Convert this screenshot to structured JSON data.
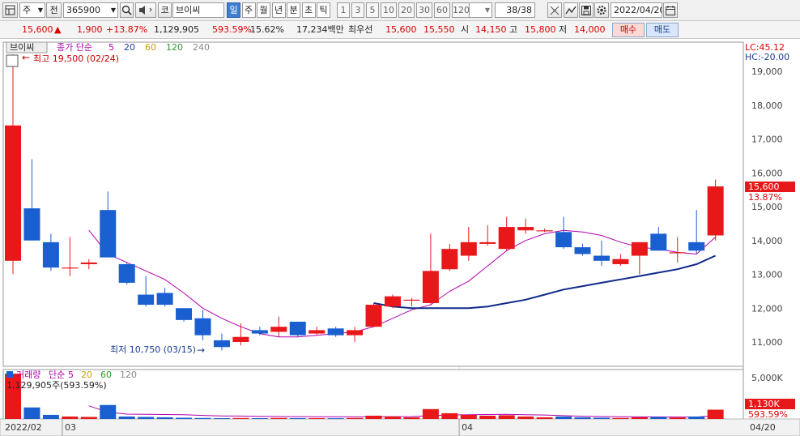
{
  "toolbar": {
    "market": "주",
    "prev_label": "전",
    "code": "365900",
    "market2": "코",
    "name": "브이씨",
    "periods": [
      {
        "label": "일",
        "active": true
      },
      {
        "label": "주",
        "active": false
      },
      {
        "label": "월",
        "active": false
      },
      {
        "label": "년",
        "active": false
      },
      {
        "label": "분",
        "active": false
      },
      {
        "label": "초",
        "active": false
      },
      {
        "label": "틱",
        "active": false
      }
    ],
    "intervals": [
      "1",
      "3",
      "5",
      "10",
      "20",
      "30",
      "60",
      "120"
    ],
    "count": "38/38",
    "date": "2022/04/20"
  },
  "quote": {
    "price": "15,600",
    "change_arrow": "▲",
    "change": "1,900",
    "change_pct": "+13.87%",
    "volume": "1,129,905",
    "volume_ratio": "593.59%",
    "turnover_rate": "15.62%",
    "amount": "17,234백만",
    "best_label": "최우선",
    "best_ask": "15,600",
    "best_bid": "15,550",
    "open_label": "시",
    "open": "14,150",
    "high_label": "고",
    "high": "15,800",
    "low_label": "저",
    "low": "14,000",
    "buy_label": "매수",
    "sell_label": "매도"
  },
  "chart": {
    "name_tag": "브이씨",
    "legend": [
      {
        "label": "종가 단순",
        "color": "#b000b0"
      },
      {
        "label": "5",
        "color": "#b000b0"
      },
      {
        "label": "20",
        "color": "#1c3aa8"
      },
      {
        "label": "60",
        "color": "#c8a000"
      },
      {
        "label": "120",
        "color": "#2a9a2a"
      },
      {
        "label": "240",
        "color": "#888888"
      }
    ],
    "high_note": "최고 19,500 (02/24)",
    "low_note": "최저 10,750 (03/15)",
    "lc": "LC:45.12",
    "hc": "HC:-20.00",
    "current_tag": "15,600",
    "current_pct": "13.87%",
    "vol_legend": [
      {
        "label": "거래량",
        "color": "#b000b0"
      },
      {
        "label": "단순",
        "color": "#b000b0"
      },
      {
        "label": "5",
        "color": "#b000b0"
      },
      {
        "label": "20",
        "color": "#c8a000"
      },
      {
        "label": "60",
        "color": "#2a9a2a"
      },
      {
        "label": "120",
        "color": "#888888"
      }
    ],
    "vol_note": "1,129,905주(593.59%)",
    "vol_axis": "5,000K",
    "vol_tag": "1,130K",
    "vol_pct": "593.59%",
    "date_labels": [
      "2022/02",
      "03",
      "04",
      "04/20"
    ],
    "colors": {
      "up": "#e8181a",
      "down": "#1a5fcf",
      "ma5": "#b000b0",
      "ma20": "#102a8a",
      "grid": "#e2e2e2"
    }
  },
  "chart_data": {
    "type": "candlestick",
    "ylim": [
      10500,
      19800
    ],
    "yticks": [
      11000,
      12000,
      13000,
      14000,
      15000,
      16000,
      17000,
      18000,
      19000
    ],
    "candles": [
      {
        "o": 13400,
        "h": 19500,
        "l": 13000,
        "c": 17400
      },
      {
        "o": 14950,
        "h": 16400,
        "l": 14000,
        "c": 14000
      },
      {
        "o": 13950,
        "h": 14200,
        "l": 13100,
        "c": 13200
      },
      {
        "o": 13200,
        "h": 14100,
        "l": 12950,
        "c": 13200
      },
      {
        "o": 13300,
        "h": 13450,
        "l": 13150,
        "c": 13350
      },
      {
        "o": 14900,
        "h": 15450,
        "l": 13500,
        "c": 13500
      },
      {
        "o": 13300,
        "h": 13350,
        "l": 12700,
        "c": 12750
      },
      {
        "o": 12400,
        "h": 12950,
        "l": 12050,
        "c": 12100
      },
      {
        "o": 12450,
        "h": 12600,
        "l": 12050,
        "c": 12100
      },
      {
        "o": 12000,
        "h": 12000,
        "l": 11600,
        "c": 11650
      },
      {
        "o": 11700,
        "h": 11950,
        "l": 11050,
        "c": 11200
      },
      {
        "o": 11050,
        "h": 11250,
        "l": 10750,
        "c": 10850
      },
      {
        "o": 11000,
        "h": 11550,
        "l": 10900,
        "c": 11150
      },
      {
        "o": 11350,
        "h": 11450,
        "l": 11200,
        "c": 11250
      },
      {
        "o": 11300,
        "h": 11750,
        "l": 11150,
        "c": 11450
      },
      {
        "o": 11600,
        "h": 11600,
        "l": 11150,
        "c": 11200
      },
      {
        "o": 11250,
        "h": 11450,
        "l": 11200,
        "c": 11350
      },
      {
        "o": 11400,
        "h": 11450,
        "l": 11150,
        "c": 11200
      },
      {
        "o": 11200,
        "h": 11450,
        "l": 11000,
        "c": 11350
      },
      {
        "o": 11450,
        "h": 12150,
        "l": 11450,
        "c": 12100
      },
      {
        "o": 12050,
        "h": 12400,
        "l": 12000,
        "c": 12350
      },
      {
        "o": 12250,
        "h": 12300,
        "l": 12050,
        "c": 12250
      },
      {
        "o": 12150,
        "h": 14200,
        "l": 12100,
        "c": 13100
      },
      {
        "o": 13150,
        "h": 13900,
        "l": 13100,
        "c": 13750
      },
      {
        "o": 13550,
        "h": 14400,
        "l": 13400,
        "c": 13950
      },
      {
        "o": 13900,
        "h": 14450,
        "l": 13850,
        "c": 13950
      },
      {
        "o": 13750,
        "h": 14700,
        "l": 13700,
        "c": 14400
      },
      {
        "o": 14300,
        "h": 14650,
        "l": 14200,
        "c": 14400
      },
      {
        "o": 14300,
        "h": 14350,
        "l": 14250,
        "c": 14300
      },
      {
        "o": 14250,
        "h": 14700,
        "l": 13750,
        "c": 13800
      },
      {
        "o": 13800,
        "h": 13900,
        "l": 13550,
        "c": 13600
      },
      {
        "o": 13550,
        "h": 14000,
        "l": 13250,
        "c": 13400
      },
      {
        "o": 13300,
        "h": 13600,
        "l": 13250,
        "c": 13450
      },
      {
        "o": 13550,
        "h": 13950,
        "l": 13000,
        "c": 13950
      },
      {
        "o": 14200,
        "h": 14400,
        "l": 13700,
        "c": 13700
      },
      {
        "o": 13650,
        "h": 14100,
        "l": 13350,
        "c": 13650
      },
      {
        "o": 13950,
        "h": 14900,
        "l": 13600,
        "c": 13700
      },
      {
        "o": 14150,
        "h": 15800,
        "l": 14000,
        "c": 15600
      }
    ],
    "ma5": [
      null,
      null,
      null,
      null,
      14300,
      13600,
      13350,
      13100,
      12850,
      12450,
      12000,
      11700,
      11450,
      11250,
      11150,
      11150,
      11200,
      11250,
      11300,
      11450,
      11700,
      11950,
      12100,
      12500,
      12800,
      13250,
      13700,
      14000,
      14200,
      14300,
      14250,
      14150,
      13950,
      13800,
      13750,
      13650,
      13600,
      14100
    ],
    "ma20": [
      null,
      null,
      null,
      null,
      null,
      null,
      null,
      null,
      null,
      null,
      null,
      null,
      null,
      null,
      null,
      null,
      null,
      null,
      null,
      12150,
      12050,
      12000,
      12000,
      12000,
      12000,
      12050,
      12150,
      12250,
      12400,
      12550,
      12650,
      12750,
      12850,
      12950,
      13050,
      13150,
      13300,
      13550
    ],
    "volume_ylim": [
      0,
      6000
    ],
    "volumes": [
      5500,
      1400,
      500,
      300,
      250,
      1700,
      300,
      250,
      200,
      150,
      120,
      100,
      120,
      100,
      120,
      100,
      100,
      90,
      120,
      400,
      300,
      200,
      1200,
      700,
      500,
      400,
      450,
      300,
      200,
      300,
      200,
      150,
      120,
      200,
      250,
      180,
      300,
      1130
    ],
    "vol_ma5": [
      null,
      null,
      null,
      null,
      1590,
      830,
      590,
      560,
      540,
      520,
      430,
      370,
      350,
      320,
      300,
      290,
      280,
      270,
      260,
      270,
      290,
      300,
      400,
      480,
      520,
      540,
      560,
      520,
      480,
      400,
      330,
      300,
      280,
      260,
      250,
      240,
      240,
      400
    ]
  }
}
